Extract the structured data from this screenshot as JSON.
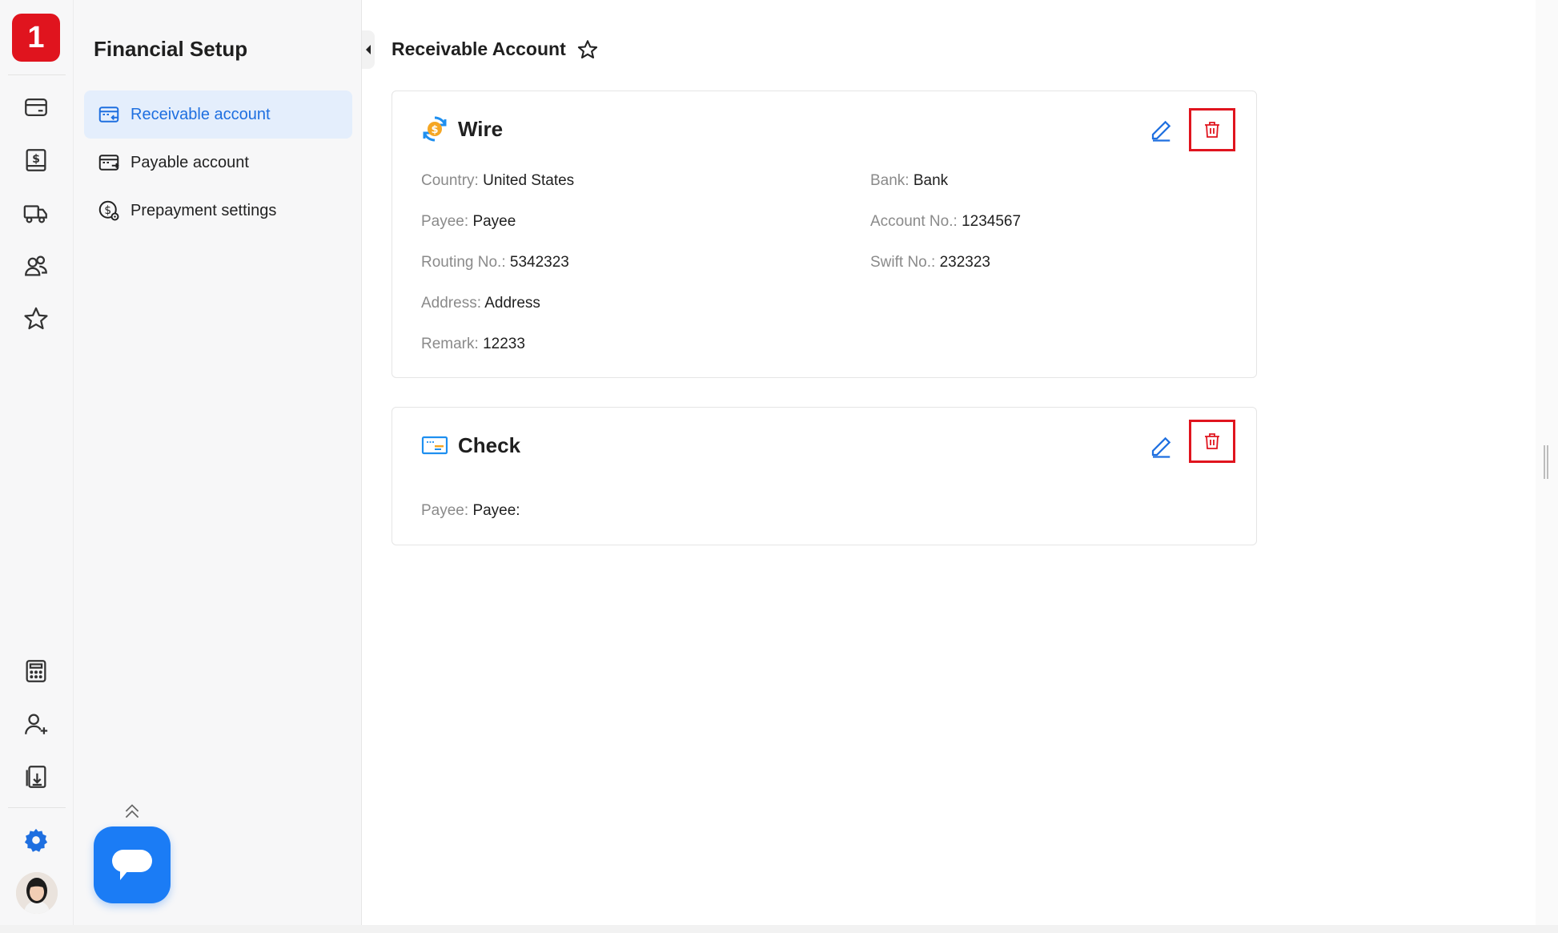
{
  "app": {
    "logo_text": "1",
    "accent_color": "#1e6fe0",
    "brand_color": "#e0141e"
  },
  "rail": {
    "top_icons": [
      "card-icon",
      "invoice-dollar-icon",
      "truck-icon",
      "users-icon",
      "star-icon"
    ],
    "bottom_icons": [
      "calculator-icon",
      "add-user-icon",
      "export-icon",
      "gear-icon"
    ]
  },
  "sidepanel": {
    "title": "Financial Setup",
    "items": [
      {
        "label": "Receivable account",
        "icon": "receivable-card-icon",
        "active": true
      },
      {
        "label": "Payable account",
        "icon": "payable-card-icon",
        "active": false
      },
      {
        "label": "Prepayment settings",
        "icon": "prepayment-icon",
        "active": false
      }
    ]
  },
  "main": {
    "title": "Receivable Account",
    "cards": [
      {
        "title": "Wire",
        "icon": "wire-dollar-icon",
        "fields_left": [
          {
            "label": "Country:",
            "value": "United States"
          },
          {
            "label": "Payee:",
            "value": "Payee"
          },
          {
            "label": "Routing No.:",
            "value": "5342323"
          },
          {
            "label": "Address:",
            "value": "Address"
          },
          {
            "label": "Remark:",
            "value": "12233"
          }
        ],
        "fields_right": [
          {
            "label": "Bank:",
            "value": "Bank"
          },
          {
            "label": "Account No.:",
            "value": "1234567"
          },
          {
            "label": "Swift No.:",
            "value": "232323"
          }
        ]
      },
      {
        "title": "Check",
        "icon": "check-icon",
        "fields_left": [
          {
            "label": "Payee:",
            "value": "Payee:"
          }
        ]
      }
    ]
  }
}
